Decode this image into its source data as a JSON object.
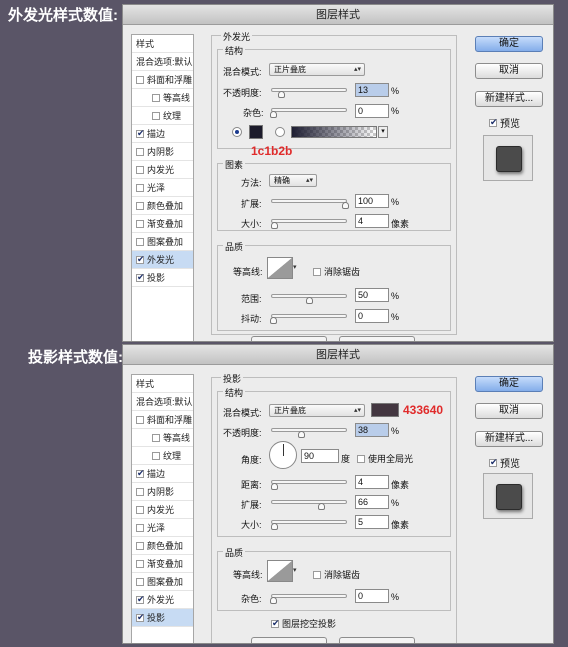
{
  "captions": {
    "outer_glow": "外发光样式数值:",
    "drop_shadow": "投影样式数值:"
  },
  "dialog_title": "图层样式",
  "buttons": {
    "ok": "确定",
    "cancel": "取消",
    "new_style": "新建样式...",
    "preview": "预览"
  },
  "sidebar": {
    "header": "样式",
    "blend_default": "混合选项:默认",
    "items": [
      {
        "label": "斜面和浮雕",
        "checked": false,
        "indent": false
      },
      {
        "label": "等高线",
        "checked": false,
        "indent": true
      },
      {
        "label": "纹理",
        "checked": false,
        "indent": true
      },
      {
        "label": "描边",
        "checked": true,
        "indent": false
      },
      {
        "label": "内阴影",
        "checked": false,
        "indent": false
      },
      {
        "label": "内发光",
        "checked": false,
        "indent": false
      },
      {
        "label": "光泽",
        "checked": false,
        "indent": false
      },
      {
        "label": "颜色叠加",
        "checked": false,
        "indent": false
      },
      {
        "label": "渐变叠加",
        "checked": false,
        "indent": false
      },
      {
        "label": "图案叠加",
        "checked": false,
        "indent": false
      },
      {
        "label": "外发光",
        "checked": true,
        "indent": false
      },
      {
        "label": "投影",
        "checked": true,
        "indent": false
      }
    ]
  },
  "outer_glow": {
    "section_title": "外发光",
    "structure_title": "结构",
    "blend_mode_label": "混合模式:",
    "blend_mode": "正片叠底",
    "opacity_label": "不透明度:",
    "opacity": "13",
    "noise_label": "杂色:",
    "noise": "0",
    "percent": "%",
    "color_annotation": "1c1b2b",
    "color": "#1c1b2b",
    "elements_title": "图素",
    "method_label": "方法:",
    "method": "精确",
    "spread_label": "扩展:",
    "spread": "100",
    "size_label": "大小:",
    "size": "4",
    "px": "像素",
    "quality_title": "品质",
    "contour_label": "等高线:",
    "antialias_label": "消除锯齿",
    "range_label": "范围:",
    "range": "50",
    "jitter_label": "抖动:",
    "jitter": "0"
  },
  "drop_shadow": {
    "section_title": "投影",
    "structure_title": "结构",
    "blend_mode_label": "混合模式:",
    "blend_mode": "正片叠底",
    "color": "#433640",
    "color_annotation": "433640",
    "opacity_label": "不透明度:",
    "opacity": "38",
    "percent": "%",
    "angle_label": "角度:",
    "angle": "90",
    "degree": "度",
    "global_light_label": "使用全局光",
    "distance_label": "距离:",
    "distance": "4",
    "spread_label": "扩展:",
    "spread": "66",
    "size_label": "大小:",
    "size": "5",
    "px": "像素",
    "quality_title": "品质",
    "contour_label": "等高线:",
    "antialias_label": "消除锯齿",
    "noise_label": "杂色:",
    "noise": "0",
    "knockout_label": "图层挖空投影"
  }
}
